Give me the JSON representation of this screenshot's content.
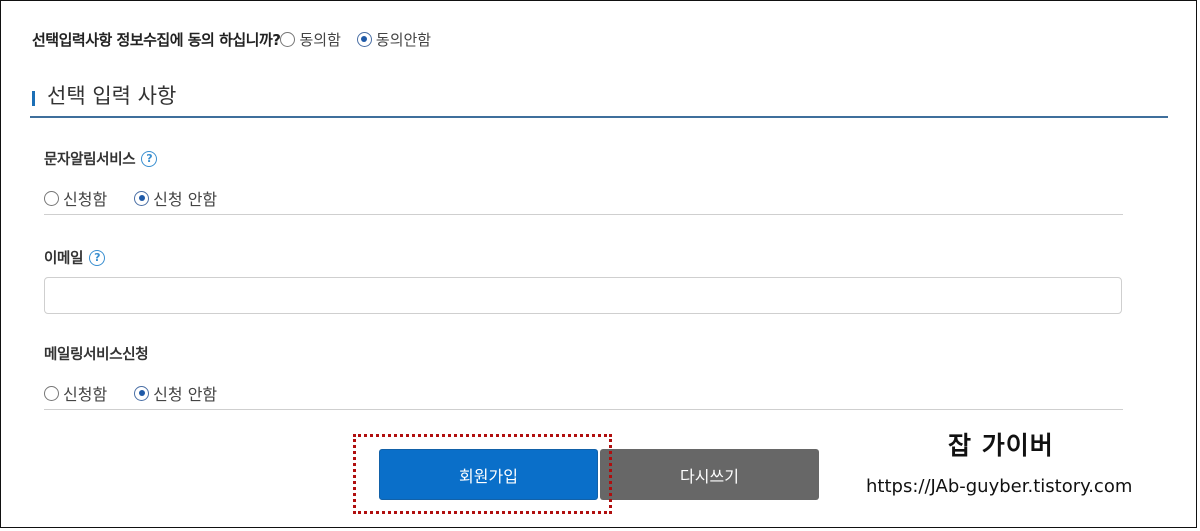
{
  "consent": {
    "question": "선택입력사항 정보수집에 동의 하십니까?",
    "options": [
      "동의함",
      "동의안함"
    ],
    "selected": "동의안함"
  },
  "section": {
    "title": "선택 입력 사항"
  },
  "sms_service": {
    "label": "문자알림서비스",
    "help_icon": "?",
    "options": [
      "신청함",
      "신청 안함"
    ],
    "selected": "신청 안함"
  },
  "email": {
    "label": "이메일",
    "help_icon": "?",
    "value": "",
    "placeholder": ""
  },
  "mailing_service": {
    "label": "메일링서비스신청",
    "options": [
      "신청함",
      "신청 안함"
    ],
    "selected": "신청 안함"
  },
  "buttons": {
    "join": "회원가입",
    "reset": "다시쓰기"
  },
  "watermark": {
    "title": "잡 가이버",
    "url": "https://JAb-guyber.tistory.com"
  },
  "colors": {
    "accent": "#0a6fc9",
    "reset_button": "#676767",
    "section_line": "#3f6f9c",
    "highlight_box": "#b00e0e"
  }
}
